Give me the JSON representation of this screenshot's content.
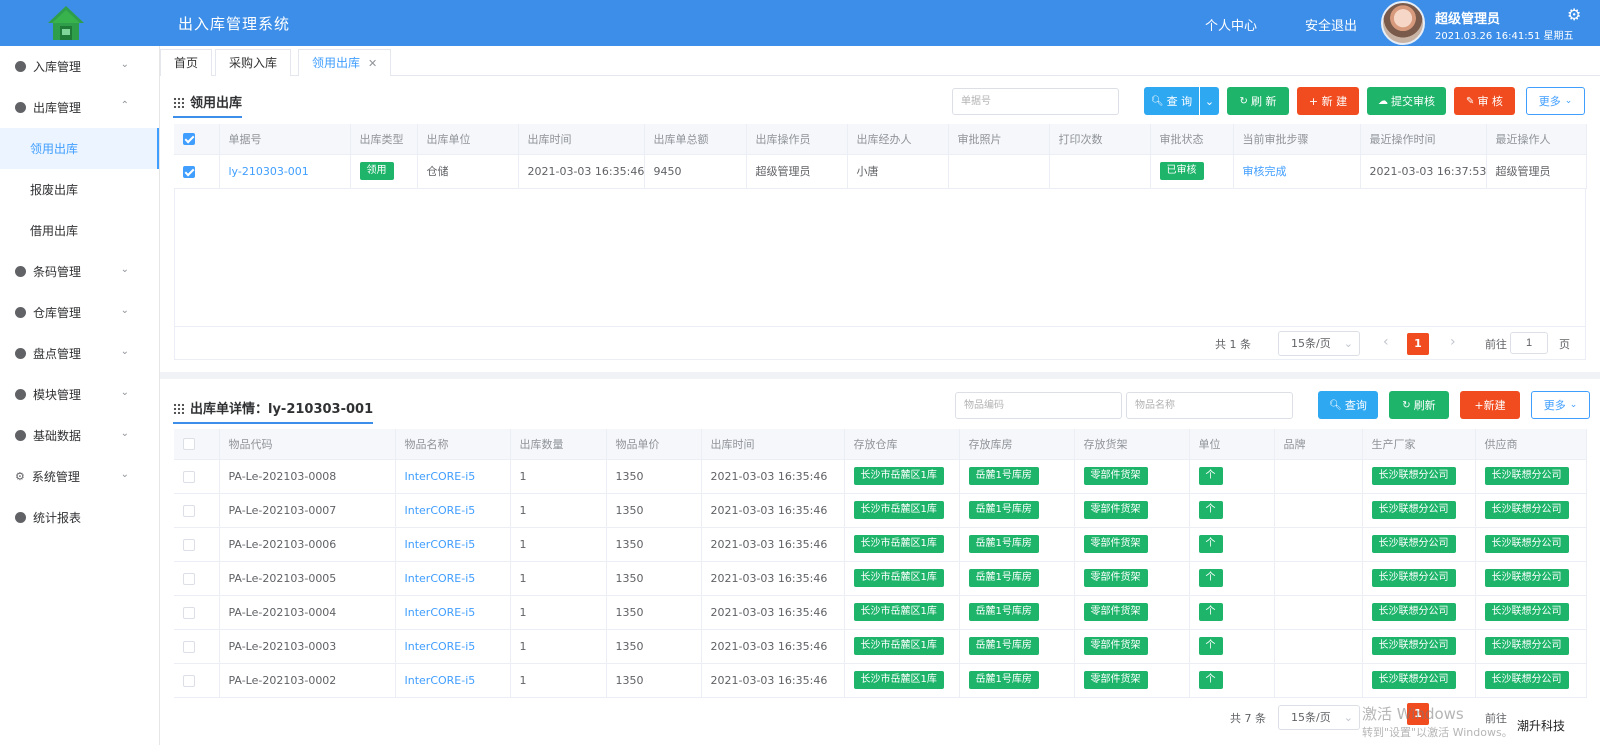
{
  "header": {
    "title": "出入库管理系统",
    "user_center": "个人中心",
    "logout": "安全退出",
    "user_name": "超级管理员",
    "datetime": "2021.03.26 16:41:51 星期五"
  },
  "sidebar": {
    "inbound": "入库管理",
    "outbound": "出库管理",
    "sub_use": "领用出库",
    "sub_scrap": "报废出库",
    "sub_borrow": "借用出库",
    "barcode": "条码管理",
    "warehouse": "仓库管理",
    "inventory": "盘点管理",
    "module": "模块管理",
    "basic": "基础数据",
    "system": "系统管理",
    "report": "统计报表"
  },
  "tabs": {
    "home": "首页",
    "purchase": "采购入库",
    "current": "领用出库",
    "close": "✕"
  },
  "top": {
    "title": "领用出库",
    "search_placeholder": "单据号",
    "query": "查 询",
    "refresh": "刷 新",
    "create": "+ 新 建",
    "submit": "提交审核",
    "audit": "审 核",
    "more": "更多",
    "headers": [
      "单据号",
      "出库类型",
      "出库单位",
      "出库时间",
      "出库单总额",
      "出库操作员",
      "出库经办人",
      "审批照片",
      "打印次数",
      "审批状态",
      "当前审批步骤",
      "最近操作时间",
      "最近操作人"
    ],
    "row": {
      "no": "ly-210303-001",
      "type": "领用",
      "unit": "仓储",
      "time": "2021-03-03 16:35:46",
      "amount": "9450",
      "operator": "超级管理员",
      "handler": "小唐",
      "photo": "",
      "prints": "",
      "status": "已审核",
      "step": "审核完成",
      "last_time": "2021-03-03 16:37:53",
      "last_user": "超级管理员"
    },
    "pager": {
      "total": "共 1 条",
      "size": "15条/页",
      "page": "1",
      "goto": "前往",
      "goto_val": "1",
      "unit": "页"
    }
  },
  "bottom": {
    "title": "出库单详情：ly-210303-001",
    "code_placeholder": "物品编码",
    "name_placeholder": "物品名称",
    "query": "查询",
    "refresh": "刷新",
    "create": "+新建",
    "more": "更多",
    "headers": [
      "物品代码",
      "物品名称",
      "出库数量",
      "物品单价",
      "出库时间",
      "存放仓库",
      "存放库房",
      "存放货架",
      "单位",
      "品牌",
      "生产厂家",
      "供应商"
    ],
    "rows": [
      {
        "code": "PA-Le-202103-0008",
        "name": "InterCORE-i5",
        "qty": "1",
        "price": "1350",
        "time": "2021-03-03 16:35:46",
        "wh": "长沙市岳麓区1库",
        "room": "岳麓1号库房",
        "shelf": "零部件货架",
        "unit": "个",
        "brand": "",
        "maker": "长沙联想分公司",
        "supplier": "长沙联想分公司"
      },
      {
        "code": "PA-Le-202103-0007",
        "name": "InterCORE-i5",
        "qty": "1",
        "price": "1350",
        "time": "2021-03-03 16:35:46",
        "wh": "长沙市岳麓区1库",
        "room": "岳麓1号库房",
        "shelf": "零部件货架",
        "unit": "个",
        "brand": "",
        "maker": "长沙联想分公司",
        "supplier": "长沙联想分公司"
      },
      {
        "code": "PA-Le-202103-0006",
        "name": "InterCORE-i5",
        "qty": "1",
        "price": "1350",
        "time": "2021-03-03 16:35:46",
        "wh": "长沙市岳麓区1库",
        "room": "岳麓1号库房",
        "shelf": "零部件货架",
        "unit": "个",
        "brand": "",
        "maker": "长沙联想分公司",
        "supplier": "长沙联想分公司"
      },
      {
        "code": "PA-Le-202103-0005",
        "name": "InterCORE-i5",
        "qty": "1",
        "price": "1350",
        "time": "2021-03-03 16:35:46",
        "wh": "长沙市岳麓区1库",
        "room": "岳麓1号库房",
        "shelf": "零部件货架",
        "unit": "个",
        "brand": "",
        "maker": "长沙联想分公司",
        "supplier": "长沙联想分公司"
      },
      {
        "code": "PA-Le-202103-0004",
        "name": "InterCORE-i5",
        "qty": "1",
        "price": "1350",
        "time": "2021-03-03 16:35:46",
        "wh": "长沙市岳麓区1库",
        "room": "岳麓1号库房",
        "shelf": "零部件货架",
        "unit": "个",
        "brand": "",
        "maker": "长沙联想分公司",
        "supplier": "长沙联想分公司"
      },
      {
        "code": "PA-Le-202103-0003",
        "name": "InterCORE-i5",
        "qty": "1",
        "price": "1350",
        "time": "2021-03-03 16:35:46",
        "wh": "长沙市岳麓区1库",
        "room": "岳麓1号库房",
        "shelf": "零部件货架",
        "unit": "个",
        "brand": "",
        "maker": "长沙联想分公司",
        "supplier": "长沙联想分公司"
      },
      {
        "code": "PA-Le-202103-0002",
        "name": "InterCORE-i5",
        "qty": "1",
        "price": "1350",
        "time": "2021-03-03 16:35:46",
        "wh": "长沙市岳麓区1库",
        "room": "岳麓1号库房",
        "shelf": "零部件货架",
        "unit": "个",
        "brand": "",
        "maker": "长沙联想分公司",
        "supplier": "长沙联想分公司"
      }
    ],
    "pager": {
      "total": "共 7 条",
      "size": "15条/页",
      "page": "1",
      "goto": "前往"
    }
  },
  "overlay": {
    "watermark1": "激活 Windows",
    "watermark2": "转到\"设置\"以激活 Windows。",
    "brand": "潮升科技"
  },
  "colors": {
    "header": "#3c8ee8",
    "primary": "#409eff",
    "green": "#1eb56b",
    "red": "#f04c1f",
    "cyan": "#2fa8f2"
  }
}
